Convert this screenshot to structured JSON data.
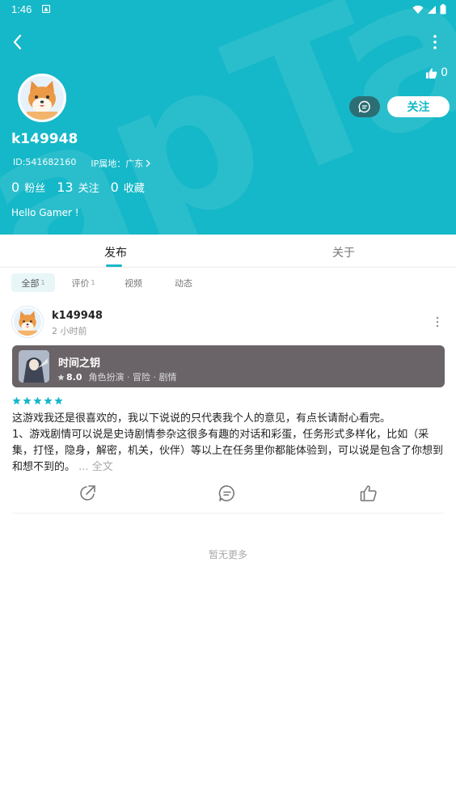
{
  "colors": {
    "accent": "#15b8c8",
    "card_bg": "#6a6367",
    "star": "#15b8c8"
  },
  "status_bar": {
    "time": "1:46"
  },
  "profile": {
    "like_count": "0",
    "username": "k149948",
    "id_text": "ID:541682160",
    "ip_text": "IP属地：广东",
    "follow_label": "关注",
    "bio": "Hello Gamer !",
    "stats": [
      {
        "num": "0",
        "label": "粉丝"
      },
      {
        "num": "13",
        "label": "关注"
      },
      {
        "num": "0",
        "label": "收藏"
      }
    ]
  },
  "tabs": [
    {
      "label": "发布"
    },
    {
      "label": "关于"
    }
  ],
  "sub_tabs": [
    {
      "label": "全部",
      "count": "1"
    },
    {
      "label": "评价",
      "count": "1"
    },
    {
      "label": "视频",
      "count": ""
    },
    {
      "label": "动态",
      "count": ""
    }
  ],
  "post": {
    "username": "k149948",
    "time": "2 小时前",
    "rating_stars": 5,
    "game": {
      "title": "时间之钥",
      "score": "8.0",
      "tags": "角色扮演 · 冒险 · 剧情"
    },
    "text_line1": "这游戏我还是很喜欢的，我以下说说的只代表我个人的意见，有点长请耐心看完。",
    "text_line2": "1、游戏剧情可以说是史诗剧情参杂这很多有趣的对话和彩蛋，任务形式多样化，比如（采集，打怪，隐身，解密，机关，伙伴）等以上在任务里你都能体验到，可以说是包含了你想到和想不到的。",
    "ellipsis": " ... ",
    "expand_label": "全文"
  },
  "footer": {
    "no_more": "暂无更多"
  }
}
